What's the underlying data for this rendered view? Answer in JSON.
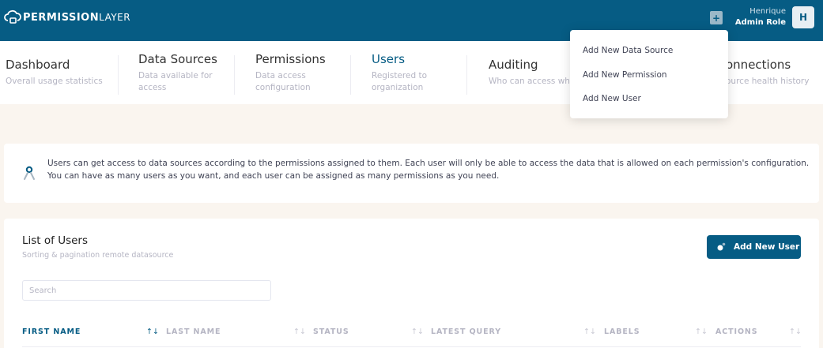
{
  "header": {
    "logo_bold": "PERMISSION",
    "logo_thin": "LAYER",
    "user_name": "Henrique",
    "user_role": "Admin Role",
    "avatar_initial": "H",
    "brand_color": "#065c84"
  },
  "nav": {
    "tabs": [
      {
        "title": "Dashboard",
        "subtitle": "Overall usage statistics"
      },
      {
        "title": "Data Sources",
        "subtitle": "Data available for",
        "subtitle2": "access"
      },
      {
        "title": "Permissions",
        "subtitle": "Data access",
        "subtitle2": "configuration"
      },
      {
        "title": "Users",
        "subtitle": "Registered to",
        "subtitle2": "organization",
        "active": true
      },
      {
        "title": "Auditing",
        "subtitle": "Who can access wh"
      },
      {
        "title": "onnections",
        "subtitle": "ource health history"
      }
    ]
  },
  "dropdown": {
    "items": [
      "Add New Data Source",
      "Add New Permission",
      "Add New User"
    ]
  },
  "notice": {
    "line1": "Users can get access to data sources according to the permissions assigned to them. Each user will only be able to access the data that is allowed on each permission's configuration.",
    "line2": "You can have as many users as you want, and each user can be assigned as many permissions as you need."
  },
  "users_card": {
    "title": "List of Users",
    "subtitle": "Sorting & pagination remote datasource",
    "add_button_label": "Add New User",
    "search_placeholder": "Search",
    "search_value": "",
    "columns": [
      "FIRST NAME",
      "LAST NAME",
      "STATUS",
      "LATEST QUERY",
      "LABELS",
      "ACTIONS"
    ],
    "sort_icons": [
      "↑↓",
      "↑↓",
      "↑↓",
      "↑↓",
      "↑↓",
      "↑↓"
    ]
  }
}
